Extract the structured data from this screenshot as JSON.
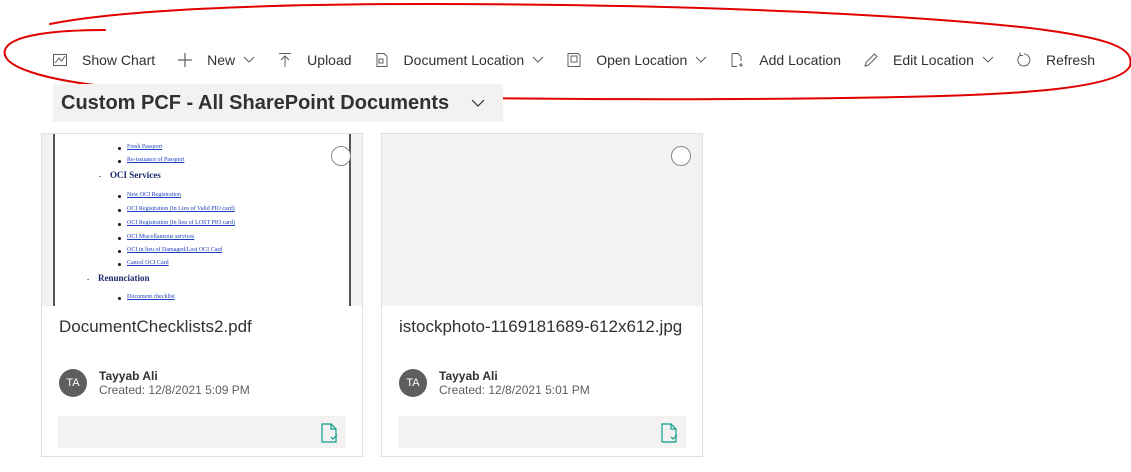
{
  "toolbar": {
    "show_chart": "Show Chart",
    "new": "New",
    "upload": "Upload",
    "document_location": "Document Location",
    "open_location": "Open Location",
    "add_location": "Add Location",
    "edit_location": "Edit Location",
    "refresh": "Refresh"
  },
  "view": {
    "title": "Custom PCF - All SharePoint Documents"
  },
  "pdf_preview": {
    "links_top": [
      "Fresh Passport",
      "Re-issuance of Passport"
    ],
    "heading_oci": "OCI Services",
    "links_oci": [
      "New OCI Registration",
      "OCI Registration (In Lieu of Valid PIO card)",
      "OCI Registration (In lieu of LOST PIO card)",
      "OCI Miscellaneous services",
      "OCI in lieu of Damaged/Lost OCI Card",
      "Cancel OCI Card"
    ],
    "heading_renunciation": "Renunciation",
    "links_renunciation": [
      "Document checklist"
    ]
  },
  "cards": [
    {
      "name": "DocumentChecklists2.pdf",
      "initials": "TA",
      "author": "Tayyab Ali",
      "created": "Created: 12/8/2021 5:09 PM"
    },
    {
      "name": "istockphoto-1169181689-612x612.jpg",
      "initials": "TA",
      "author": "Tayyab Ali",
      "created": "Created: 12/8/2021 5:01 PM"
    }
  ],
  "colors": {
    "annotation": "#e00000",
    "accent_icon": "#0f9d8a"
  }
}
